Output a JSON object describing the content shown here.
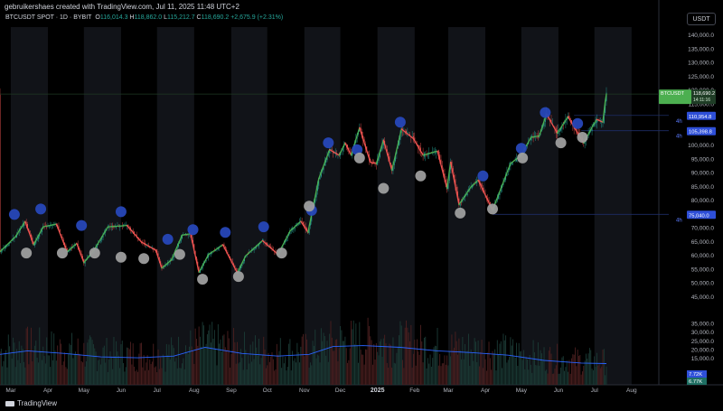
{
  "header": {
    "attribution": "gebruikershaes created with TradingView.com, Jul 11, 2025 11:48 UTC+2",
    "currency_button": "USDT",
    "footer_brand": "TradingView"
  },
  "legend": {
    "symbol": "BTCUSDT SPOT · 1D · BYBIT",
    "open_label": "O",
    "open": "116,014.3",
    "high_label": "H",
    "high": "118,862.0",
    "low_label": "L",
    "low": "115,212.7",
    "close_label": "C",
    "close": "118,690.2",
    "change": "+2,675.9 (+2.31%)"
  },
  "price_badges": {
    "last": {
      "symbol": "BTCUSDT",
      "price": "118,690.2",
      "countdown": "14:11:16"
    },
    "level_4h_high": {
      "tag": "4h",
      "price": "110,954.8"
    },
    "level_4h_mid": {
      "tag": "4h",
      "price": "105,398.8"
    },
    "level_4h_low": {
      "tag": "4h",
      "price": "75,040.0"
    }
  },
  "volume_badges": [
    "7.72K",
    "6.77K"
  ],
  "colors": {
    "background": "#000000",
    "candle_up": "#26a69a",
    "candle_down": "#ef5350",
    "line_up": "#4caf50",
    "circle_high": "#2747b8",
    "circle_low": "#9e9e9e",
    "volume_ma": "#2962ff",
    "last_price": "#4caf50",
    "level_line": "#2962ff"
  },
  "chart_data": {
    "type": "candlestick",
    "y_axis": {
      "ticks": [
        140000,
        135000,
        130000,
        125000,
        120000,
        115000,
        110000,
        105000,
        100000,
        95000,
        90000,
        85000,
        80000,
        75000,
        70000,
        65000,
        60000,
        55000,
        50000,
        45000
      ],
      "tick_labels": [
        "140,000.0",
        "135,000.0",
        "130,000.0",
        "125,000.0",
        "120,000.0",
        "115,000.0",
        "110,000.0",
        "105,000.0",
        "100,000.0",
        "95,000.0",
        "90,000.0",
        "85,000.0",
        "80,000.0",
        "75,000.0",
        "70,000.0",
        "65,000.0",
        "60,000.0",
        "55,000.0",
        "50,000.0",
        "45,000.0"
      ],
      "range": [
        44000,
        143000
      ]
    },
    "volume_axis": {
      "ticks": [
        35000,
        30000,
        25000,
        20000,
        15000
      ],
      "tick_labels": [
        "35,000.0",
        "30,000.0",
        "25,000.0",
        "20,000.0",
        "15,000.0"
      ],
      "range": [
        0,
        42000
      ]
    },
    "x_axis": {
      "labels": [
        {
          "text": "Mar",
          "date": "2024-03-01"
        },
        {
          "text": "Apr",
          "date": "2024-04-01"
        },
        {
          "text": "May",
          "date": "2024-05-01"
        },
        {
          "text": "Jun",
          "date": "2024-06-01"
        },
        {
          "text": "Jul",
          "date": "2024-07-01"
        },
        {
          "text": "Aug",
          "date": "2024-08-01"
        },
        {
          "text": "Sep",
          "date": "2024-09-01"
        },
        {
          "text": "Oct",
          "date": "2024-10-01"
        },
        {
          "text": "Nov",
          "date": "2024-11-01"
        },
        {
          "text": "Dec",
          "date": "2024-12-01"
        },
        {
          "text": "2025",
          "date": "2025-01-01",
          "bold": true
        },
        {
          "text": "Feb",
          "date": "2025-02-01"
        },
        {
          "text": "Mar",
          "date": "2025-03-01"
        },
        {
          "text": "Apr",
          "date": "2025-04-01"
        },
        {
          "text": "May",
          "date": "2025-05-01"
        },
        {
          "text": "Jun",
          "date": "2025-06-01"
        },
        {
          "text": "Jul",
          "date": "2025-07-01"
        },
        {
          "text": "Aug",
          "date": "2025-08-01"
        }
      ],
      "range": [
        "2024-02-21",
        "2025-08-23"
      ]
    },
    "price_path": [
      {
        "date": "2024-02-21",
        "close": 61500
      },
      {
        "date": "2024-03-05",
        "close": 67000
      },
      {
        "date": "2024-03-13",
        "close": 72500
      },
      {
        "date": "2024-03-20",
        "close": 64000
      },
      {
        "date": "2024-03-28",
        "close": 70500
      },
      {
        "date": "2024-04-08",
        "close": 71500
      },
      {
        "date": "2024-04-17",
        "close": 61500
      },
      {
        "date": "2024-04-25",
        "close": 64500
      },
      {
        "date": "2024-05-01",
        "close": 57500
      },
      {
        "date": "2024-05-10",
        "close": 62500
      },
      {
        "date": "2024-05-21",
        "close": 70500
      },
      {
        "date": "2024-06-06",
        "close": 71000
      },
      {
        "date": "2024-06-18",
        "close": 65000
      },
      {
        "date": "2024-06-30",
        "close": 62000
      },
      {
        "date": "2024-07-05",
        "close": 55500
      },
      {
        "date": "2024-07-13",
        "close": 58500
      },
      {
        "date": "2024-07-22",
        "close": 67500
      },
      {
        "date": "2024-07-29",
        "close": 68000
      },
      {
        "date": "2024-08-05",
        "close": 54000
      },
      {
        "date": "2024-08-13",
        "close": 60500
      },
      {
        "date": "2024-08-25",
        "close": 64000
      },
      {
        "date": "2024-09-06",
        "close": 53800
      },
      {
        "date": "2024-09-13",
        "close": 60000
      },
      {
        "date": "2024-09-27",
        "close": 65500
      },
      {
        "date": "2024-10-10",
        "close": 60500
      },
      {
        "date": "2024-10-20",
        "close": 69000
      },
      {
        "date": "2024-10-29",
        "close": 72500
      },
      {
        "date": "2024-11-04",
        "close": 68500
      },
      {
        "date": "2024-11-13",
        "close": 88000
      },
      {
        "date": "2024-11-22",
        "close": 98500
      },
      {
        "date": "2024-11-30",
        "close": 96500
      },
      {
        "date": "2024-12-05",
        "close": 101000
      },
      {
        "date": "2024-12-10",
        "close": 96500
      },
      {
        "date": "2024-12-17",
        "close": 106500
      },
      {
        "date": "2024-12-26",
        "close": 94000
      },
      {
        "date": "2024-12-31",
        "close": 93400
      },
      {
        "date": "2025-01-06",
        "close": 102000
      },
      {
        "date": "2025-01-13",
        "close": 91000
      },
      {
        "date": "2025-01-21",
        "close": 106000
      },
      {
        "date": "2025-01-31",
        "close": 102500
      },
      {
        "date": "2025-02-08",
        "close": 96500
      },
      {
        "date": "2025-02-20",
        "close": 98000
      },
      {
        "date": "2025-02-28",
        "close": 84500
      },
      {
        "date": "2025-03-03",
        "close": 94000
      },
      {
        "date": "2025-03-10",
        "close": 78600
      },
      {
        "date": "2025-03-20",
        "close": 85000
      },
      {
        "date": "2025-03-26",
        "close": 87500
      },
      {
        "date": "2025-04-07",
        "close": 76500
      },
      {
        "date": "2025-04-14",
        "close": 84500
      },
      {
        "date": "2025-04-22",
        "close": 93500
      },
      {
        "date": "2025-05-01",
        "close": 96500
      },
      {
        "date": "2025-05-09",
        "close": 103000
      },
      {
        "date": "2025-05-16",
        "close": 103500
      },
      {
        "date": "2025-05-22",
        "close": 111500
      },
      {
        "date": "2025-05-31",
        "close": 104500
      },
      {
        "date": "2025-06-09",
        "close": 110500
      },
      {
        "date": "2025-06-17",
        "close": 104500
      },
      {
        "date": "2025-06-22",
        "close": 100900
      },
      {
        "date": "2025-06-30",
        "close": 107500
      },
      {
        "date": "2025-07-03",
        "close": 109500
      },
      {
        "date": "2025-07-08",
        "close": 108500
      },
      {
        "date": "2025-07-10",
        "close": 116000
      },
      {
        "date": "2025-07-11",
        "close": 118690
      }
    ],
    "swing_highs": [
      {
        "date": "2024-03-04",
        "price": 75000
      },
      {
        "date": "2024-03-26",
        "price": 77000
      },
      {
        "date": "2024-04-29",
        "price": 71000
      },
      {
        "date": "2024-06-01",
        "price": 76000
      },
      {
        "date": "2024-07-10",
        "price": 66000
      },
      {
        "date": "2024-07-31",
        "price": 69500
      },
      {
        "date": "2024-08-27",
        "price": 68500
      },
      {
        "date": "2024-09-28",
        "price": 70500
      },
      {
        "date": "2024-11-07",
        "price": 76500
      },
      {
        "date": "2024-11-21",
        "price": 101000
      },
      {
        "date": "2024-12-15",
        "price": 98500
      },
      {
        "date": "2025-01-20",
        "price": 108500
      },
      {
        "date": "2025-03-30",
        "price": 89000
      },
      {
        "date": "2025-05-01",
        "price": 99000
      },
      {
        "date": "2025-05-21",
        "price": 112000
      },
      {
        "date": "2025-06-17",
        "price": 108000
      }
    ],
    "swing_lows": [
      {
        "date": "2024-03-14",
        "price": 61000
      },
      {
        "date": "2024-04-13",
        "price": 61000
      },
      {
        "date": "2024-05-10",
        "price": 61000
      },
      {
        "date": "2024-06-01",
        "price": 59500
      },
      {
        "date": "2024-06-20",
        "price": 59000
      },
      {
        "date": "2024-07-20",
        "price": 60500
      },
      {
        "date": "2024-08-08",
        "price": 51500
      },
      {
        "date": "2024-09-07",
        "price": 52500
      },
      {
        "date": "2024-10-13",
        "price": 61000
      },
      {
        "date": "2024-11-05",
        "price": 78000
      },
      {
        "date": "2024-12-17",
        "price": 95500
      },
      {
        "date": "2025-01-06",
        "price": 84500
      },
      {
        "date": "2025-02-06",
        "price": 89000
      },
      {
        "date": "2025-03-11",
        "price": 75500
      },
      {
        "date": "2025-04-07",
        "price": 77000
      },
      {
        "date": "2025-05-02",
        "price": 95500
      },
      {
        "date": "2025-06-03",
        "price": 101000
      },
      {
        "date": "2025-06-21",
        "price": 103000
      }
    ],
    "horizontal_levels": [
      {
        "price": 118690,
        "label": "last"
      },
      {
        "price": 110954.8,
        "label": "4h"
      },
      {
        "price": 105398.8,
        "label": "4h"
      },
      {
        "price": 75040.0,
        "label": "4h"
      }
    ],
    "volume_ma_path": [
      {
        "date": "2024-02-21",
        "value": 17500
      },
      {
        "date": "2024-03-15",
        "value": 19500
      },
      {
        "date": "2024-04-15",
        "value": 18000
      },
      {
        "date": "2024-05-15",
        "value": 16000
      },
      {
        "date": "2024-06-15",
        "value": 15500
      },
      {
        "date": "2024-07-15",
        "value": 16500
      },
      {
        "date": "2024-08-10",
        "value": 21500
      },
      {
        "date": "2024-09-10",
        "value": 18000
      },
      {
        "date": "2024-10-10",
        "value": 16500
      },
      {
        "date": "2024-11-05",
        "value": 17500
      },
      {
        "date": "2024-11-25",
        "value": 22000
      },
      {
        "date": "2024-12-20",
        "value": 22500
      },
      {
        "date": "2025-01-20",
        "value": 21500
      },
      {
        "date": "2025-02-20",
        "value": 19500
      },
      {
        "date": "2025-03-20",
        "value": 18500
      },
      {
        "date": "2025-04-20",
        "value": 17000
      },
      {
        "date": "2025-05-20",
        "value": 14000
      },
      {
        "date": "2025-06-20",
        "value": 12500
      },
      {
        "date": "2025-07-11",
        "value": 12200
      }
    ]
  }
}
